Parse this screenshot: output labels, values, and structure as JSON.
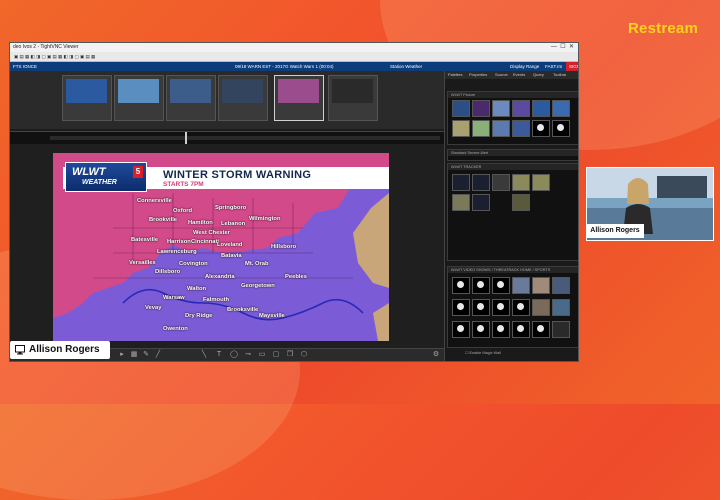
{
  "window": {
    "title": "deo Ivos 2 - TightVNC Viewer",
    "menu": "FTS IONCE",
    "status_mid_left": "09/18 WARN EST  -  2017G Watch Warn 1 (00:04)",
    "status_mid_right": "Station Weather",
    "status_right_1": "Display Range",
    "status_right_2": "FAST.rm",
    "status_red": "SIGN"
  },
  "banner": {
    "title": "WINTER STORM WARNING",
    "subtitle": "STARTS 7PM",
    "logo_line1": "WLWT",
    "logo_line2": "WEATHER",
    "logo_num": "5"
  },
  "map": {
    "cities": [
      {
        "name": "Connersville"
      },
      {
        "name": "Oxford"
      },
      {
        "name": "Springboro"
      },
      {
        "name": "Brookville"
      },
      {
        "name": "Hamilton"
      },
      {
        "name": "Lebanon"
      },
      {
        "name": "Wilmington"
      },
      {
        "name": "West Chester"
      },
      {
        "name": "Batesville"
      },
      {
        "name": "Harrison"
      },
      {
        "name": "Cincinnati"
      },
      {
        "name": "Loveland"
      },
      {
        "name": "Hillsboro"
      },
      {
        "name": "Lawrenceburg"
      },
      {
        "name": "Batavia"
      },
      {
        "name": "Versailles"
      },
      {
        "name": "Dillsboro"
      },
      {
        "name": "Covington"
      },
      {
        "name": "Mt. Orab"
      },
      {
        "name": "Alexandria"
      },
      {
        "name": "Peebles"
      },
      {
        "name": "Georgetown"
      },
      {
        "name": "Walton"
      },
      {
        "name": "Falmouth"
      },
      {
        "name": "Warsaw"
      },
      {
        "name": "Vevay"
      },
      {
        "name": "Brooksville"
      },
      {
        "name": "Maysville"
      },
      {
        "name": "Dry Ridge"
      },
      {
        "name": "Owenton"
      }
    ]
  },
  "right_panel": {
    "tabs": [
      "Palettes",
      "Properties",
      "Source",
      "Events",
      "Query",
      "Toolbar"
    ],
    "sections": [
      "WLWT Picture",
      "Standard Severe Alert",
      "WLWT TRACKER",
      "WLWT VIDEO SHOWS  /  THREATRACK HOME / SPORTS"
    ],
    "footer": "Enable Magic Wall"
  },
  "streamer": {
    "brand": "Restream",
    "name": "Allison Rogers",
    "cam_label": "Allison Rogers"
  },
  "colors": {
    "background": "#f0542c",
    "pink_zone": "#d34a8a",
    "purple_zone": "#7b5cd6",
    "tan_zone": "#c9a57a",
    "banner_title": "#13284f",
    "banner_sub": "#d23a78",
    "status_blue": "#0d3c7a",
    "brand_yellow": "#ffd21e"
  }
}
